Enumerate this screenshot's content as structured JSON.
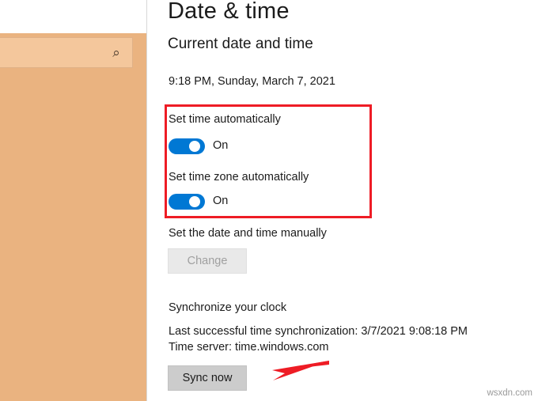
{
  "window": {
    "page_title": "Date & time",
    "section_title": "Current date and time",
    "current_datetime": "9:18 PM, Sunday, March 7, 2021"
  },
  "settings": {
    "set_time_automatically": {
      "label": "Set time automatically",
      "state": "On",
      "accent": "#0078d4"
    },
    "set_timezone_automatically": {
      "label": "Set time zone automatically",
      "state": "On",
      "accent": "#0078d4"
    },
    "manual": {
      "label": "Set the date and time manually",
      "button": "Change"
    },
    "synchronize": {
      "label": "Synchronize your clock",
      "last_sync": "Last successful time synchronization: 3/7/2021 9:08:18 PM",
      "time_server": "Time server: time.windows.com",
      "button": "Sync now"
    }
  },
  "left_pane": {
    "search_placeholder": "",
    "search_icon": "search-icon"
  },
  "annotations": {
    "highlight_color": "#ee1c25",
    "arrow_color": "#ee1c25"
  },
  "watermark": "wsxdn.com"
}
